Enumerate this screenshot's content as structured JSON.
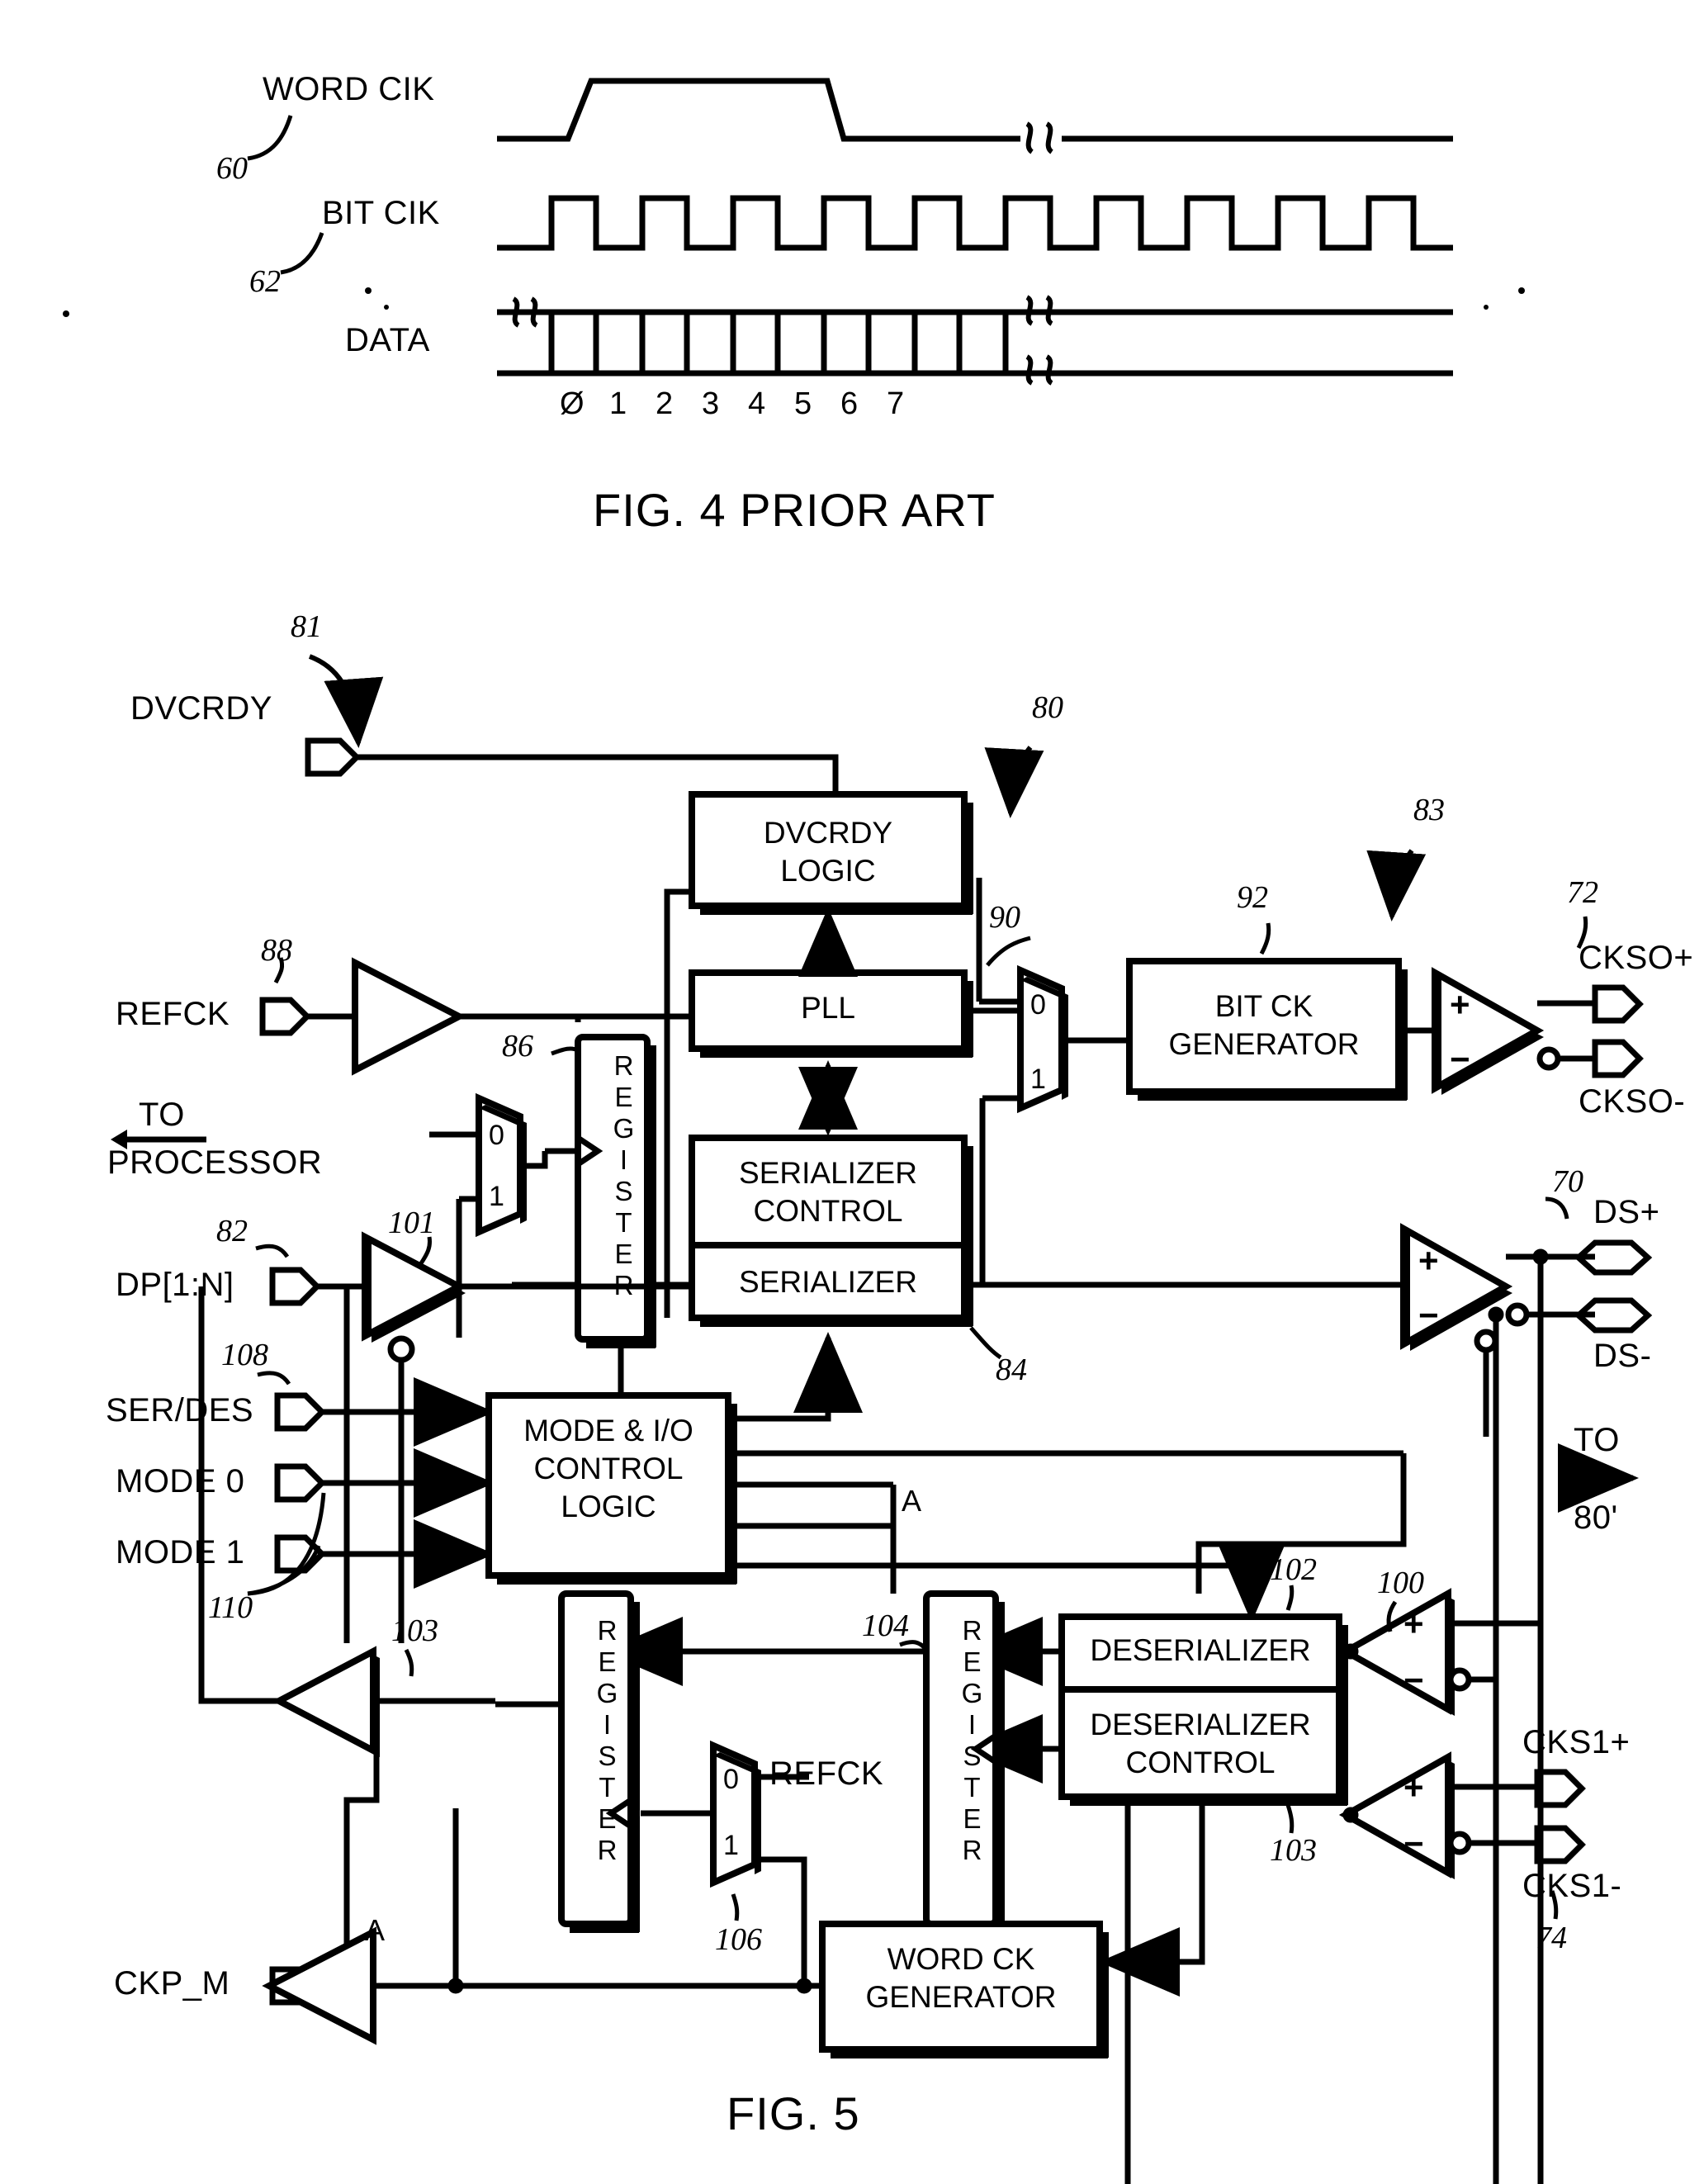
{
  "figures": [
    {
      "id": "fig4",
      "caption": "FIG. 4 PRIOR ART",
      "timing": {
        "signals": [
          {
            "name": "WORD CIK",
            "ref": "60"
          },
          {
            "name": "BIT CIK",
            "ref": "62"
          },
          {
            "name": "DATA",
            "ref": ""
          }
        ],
        "bit_labels": [
          "Ø",
          "1",
          "2",
          "3",
          "4",
          "5",
          "6",
          "7"
        ]
      }
    },
    {
      "id": "fig5",
      "caption": "FIG. 5",
      "refs": {
        "r80": "80",
        "r81": "81",
        "r82": "82",
        "r83": "83",
        "r84": "84",
        "r86": "86",
        "r88": "88",
        "r90": "90",
        "r92": "92",
        "r100": "100",
        "r101": "101",
        "r102": "102",
        "r103a": "103",
        "r103b": "103",
        "r104": "104",
        "r106": "106",
        "r108": "108",
        "r110": "110",
        "r70": "70",
        "r72": "72",
        "r74": "74"
      },
      "pins": {
        "dvcrdy": "DVCRDY",
        "refck": "REFCK",
        "dp": "DP[1:N]",
        "serdes": "SER/DES",
        "mode0": "MODE 0",
        "mode1": "MODE 1",
        "ckp_m": "CKP_M"
      },
      "outputs": {
        "ckso_p": "CKSO+",
        "ckso_n": "CKSO-",
        "ds_p": "DS+",
        "ds_n": "DS-",
        "cks1_p": "CKS1+",
        "cks1_n": "CKS1-"
      },
      "blocks": {
        "dvcrdy_logic": "DVCRDY\nLOGIC",
        "dvcrdy_logic_l1": "DVCRDY",
        "dvcrdy_logic_l2": "LOGIC",
        "pll": "PLL",
        "bit_ck_gen_l1": "BIT CK",
        "bit_ck_gen_l2": "GENERATOR",
        "serializer_control_l1": "SERIALIZER",
        "serializer_control_l2": "CONTROL",
        "serializer": "SERIALIZER",
        "mode_io_l1": "MODE & I/O",
        "mode_io_l2": "CONTROL",
        "mode_io_l3": "LOGIC",
        "deserializer": "DESERIALIZER",
        "deserializer_control_l1": "DESERIALIZER",
        "deserializer_control_l2": "CONTROL",
        "word_ck_gen_l1": "WORD CK",
        "word_ck_gen_l2": "GENERATOR",
        "register": "REGISTER"
      },
      "annotations": {
        "to_processor_l1": "TO",
        "to_processor_l2": "PROCESSOR",
        "to_80_l1": "TO",
        "to_80_l2": "80'",
        "node_a": "A",
        "refck_mux_label": "REFCK"
      },
      "mux_labels": {
        "zero": "0",
        "one": "1"
      },
      "amp_labels": {
        "plus": "+",
        "minus": "−"
      }
    }
  ],
  "style": {
    "ink": "#000000",
    "paper": "#ffffff"
  }
}
